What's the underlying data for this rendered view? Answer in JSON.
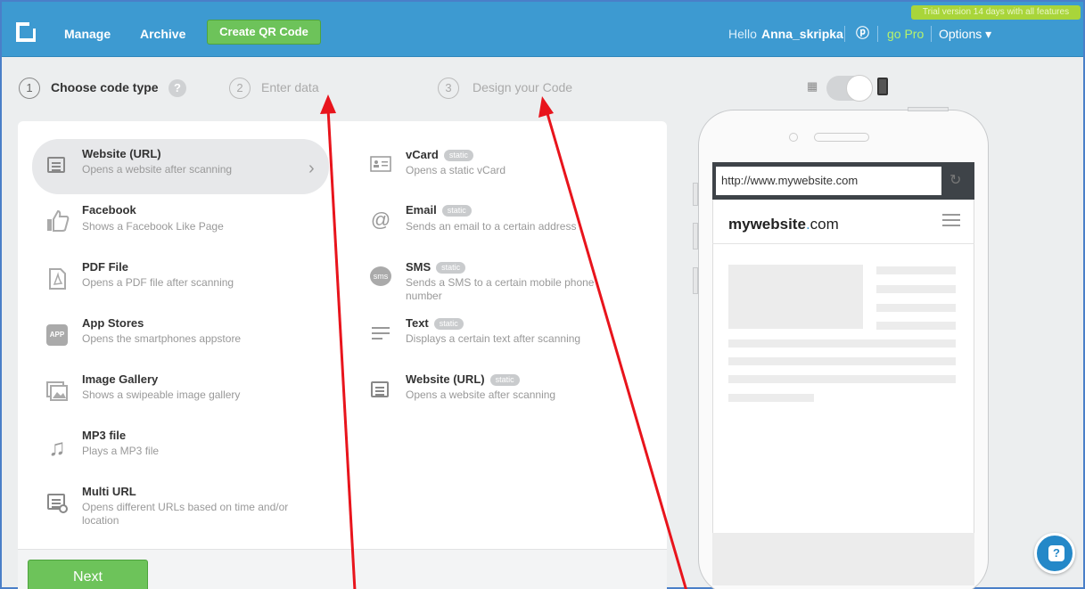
{
  "nav": {
    "manage": "Manage",
    "archive": "Archive",
    "create": "Create QR Code",
    "trial": "Trial version 14 days with all features",
    "hello": "Hello",
    "username": "Anna_skripka",
    "gopro": "go Pro",
    "options": "Options ▾"
  },
  "steps": [
    {
      "num": "1",
      "label": "Choose code type"
    },
    {
      "num": "2",
      "label": "Enter data"
    },
    {
      "num": "3",
      "label": "Design your Code"
    }
  ],
  "left_items": [
    {
      "title": "Website (URL)",
      "desc": "Opens a website after scanning",
      "icon": "browser-icon"
    },
    {
      "title": "Facebook",
      "desc": "Shows a Facebook Like Page",
      "icon": "thumbs-up-icon"
    },
    {
      "title": "PDF File",
      "desc": "Opens a PDF file after scanning",
      "icon": "pdf-icon"
    },
    {
      "title": "App Stores",
      "desc": "Opens the smartphones appstore",
      "icon": "app-icon"
    },
    {
      "title": "Image Gallery",
      "desc": "Shows a swipeable image gallery",
      "icon": "gallery-icon"
    },
    {
      "title": "MP3 file",
      "desc": "Plays a MP3 file",
      "icon": "music-note-icon"
    },
    {
      "title": "Multi URL",
      "desc": "Opens different URLs based on time and/or location",
      "icon": "multi-url-icon"
    }
  ],
  "right_items": [
    {
      "title": "vCard",
      "desc": "Opens a static vCard",
      "badge": "static"
    },
    {
      "title": "Email",
      "desc": "Sends an email to a certain address",
      "badge": "static"
    },
    {
      "title": "SMS",
      "desc": "Sends a SMS to a certain mobile phone number",
      "badge": "static"
    },
    {
      "title": "Text",
      "desc": "Displays a certain text after scanning",
      "badge": "static"
    },
    {
      "title": "Website (URL)",
      "desc": "Opens a website after scanning",
      "badge": "static"
    }
  ],
  "next_label": "Next",
  "preview": {
    "url": "http://www.mywebsite.com",
    "site_bold": "mywebsite",
    "site_dot": ".",
    "site_tld": "com"
  },
  "glyphs": {
    "help": "?",
    "chat": "ⓟ",
    "chevron": "›",
    "refresh": "↻",
    "sms": "sms",
    "app": "APP",
    "email": "@",
    "music": "♫",
    "qr": "▦"
  }
}
